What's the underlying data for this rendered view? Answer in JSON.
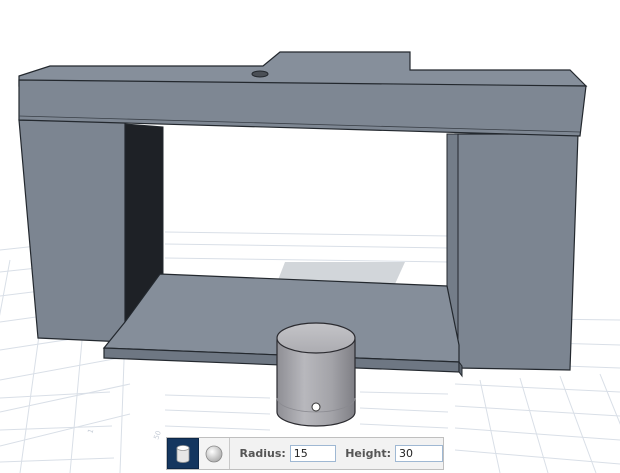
{
  "toolbar": {
    "shapes": [
      {
        "name": "cylinder",
        "icon": "cylinder-icon",
        "active": true
      },
      {
        "name": "sphere",
        "icon": "sphere-icon",
        "active": false
      }
    ],
    "radius_label": "Radius:",
    "radius_value": "15",
    "height_label": "Height:",
    "height_value": "30"
  },
  "colors": {
    "model_face": "#7d8692",
    "model_top": "#8a939f",
    "grid_line": "#d8dee6",
    "toolbar_active": "#14365f"
  }
}
